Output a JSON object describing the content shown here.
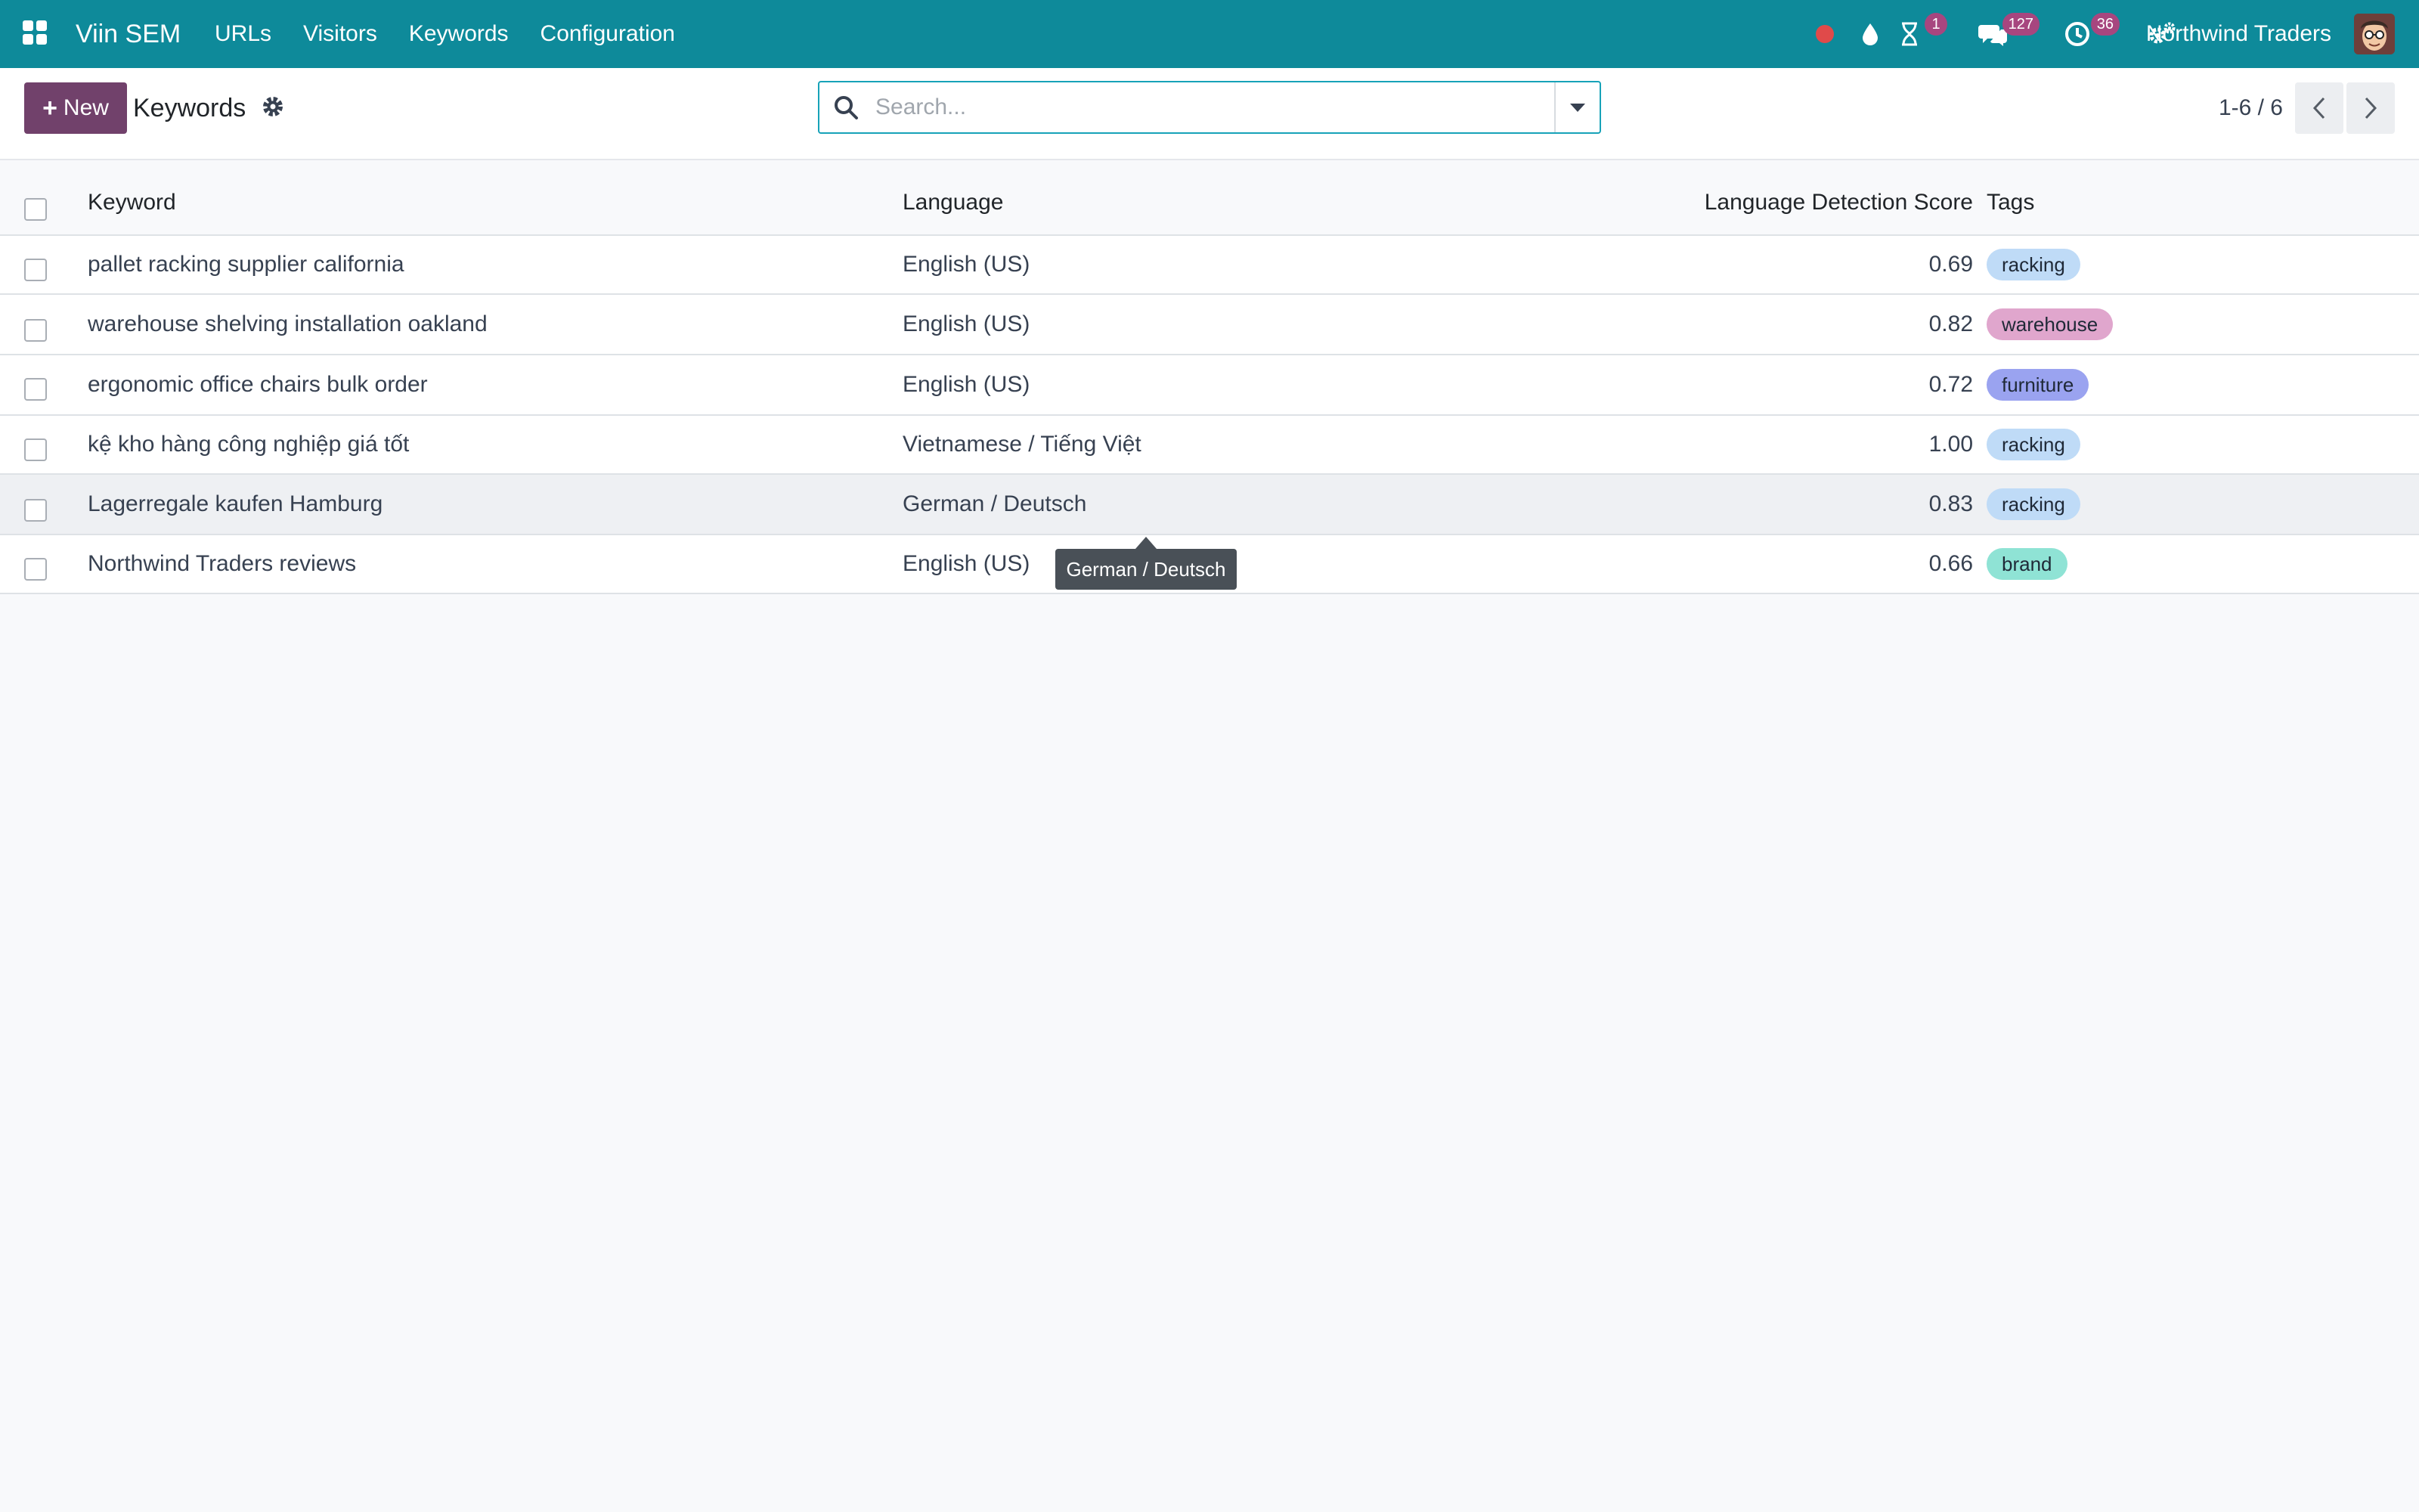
{
  "navbar": {
    "brand": "Viin SEM",
    "menu": [
      "URLs",
      "Visitors",
      "Keywords",
      "Configuration"
    ],
    "systray": {
      "activity_badge": "1",
      "messages_badge": "127",
      "clock_badge": "36"
    },
    "company": "Northwind Traders",
    "accent_color": "#0e8a9a",
    "badge_color": "#a7467f"
  },
  "control_panel": {
    "new_label": "New",
    "title": "Keywords",
    "search_placeholder": "Search...",
    "pager": "1-6 / 6",
    "primary_color": "#71416b"
  },
  "table": {
    "columns": [
      "Keyword",
      "Language",
      "Language Detection Score",
      "Tags"
    ],
    "rows": [
      {
        "keyword": "pallet racking supplier california",
        "language": "English (US)",
        "score": "0.69",
        "tag": "racking",
        "tag_color": "#bfdbf7"
      },
      {
        "keyword": "warehouse shelving installation oakland",
        "language": "English (US)",
        "score": "0.82",
        "tag": "warehouse",
        "tag_color": "#e0a6cd"
      },
      {
        "keyword": "ergonomic office chairs bulk order",
        "language": "English (US)",
        "score": "0.72",
        "tag": "furniture",
        "tag_color": "#9aa3f0"
      },
      {
        "keyword": "kệ kho hàng công nghiệp giá tốt",
        "language": "Vietnamese / Tiếng Việt",
        "score": "1.00",
        "tag": "racking",
        "tag_color": "#bfdbf7"
      },
      {
        "keyword": "Lagerregale kaufen Hamburg",
        "language": "German / Deutsch",
        "score": "0.83",
        "tag": "racking",
        "tag_color": "#bfdbf7"
      },
      {
        "keyword": "Northwind Traders reviews",
        "language": "English (US)",
        "score": "0.66",
        "tag": "brand",
        "tag_color": "#8fe3d5"
      }
    ]
  },
  "tooltip": {
    "text": "German / Deutsch"
  }
}
